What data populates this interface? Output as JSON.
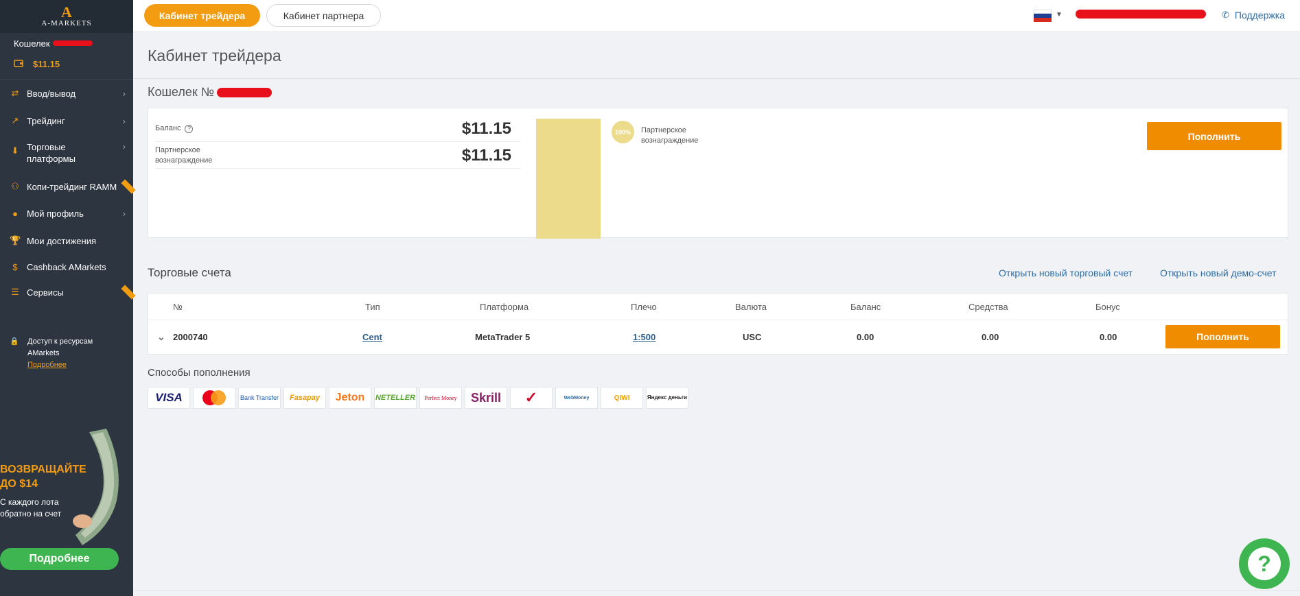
{
  "brand": {
    "name": "A-MARKETS",
    "mark": "A"
  },
  "sidebar": {
    "wallet_label": "Кошелек",
    "wallet_amount": "$11.15",
    "items": [
      {
        "label": "Ввод/вывод",
        "icon": "transfer-icon",
        "has_chevron": true
      },
      {
        "label": "Трейдинг",
        "icon": "chart-icon",
        "has_chevron": true
      },
      {
        "label": "Торговые платформы",
        "icon": "download-icon",
        "has_chevron": true
      },
      {
        "label": "Копи-трейдинг RAMM",
        "icon": "copy-trading-icon",
        "has_chevron": false,
        "badge": true
      },
      {
        "label": "Мой профиль",
        "icon": "user-icon",
        "has_chevron": true
      },
      {
        "label": "Мои достижения",
        "icon": "trophy-icon",
        "has_chevron": false
      },
      {
        "label": "Cashback AMarkets",
        "icon": "cashback-icon",
        "has_chevron": false
      },
      {
        "label": "Сервисы",
        "icon": "services-icon",
        "has_chevron": false,
        "badge": true
      }
    ],
    "access": {
      "line1": "Доступ к ресурсам",
      "line2": "AMarkets",
      "link": "Подробнее"
    },
    "promo": {
      "headline1": "ВОЗВРАЩАЙТЕ",
      "headline2": "ДО $14",
      "text1": "С каждого лота",
      "text2": "обратно на счет",
      "button": "Подробнее"
    }
  },
  "topbar": {
    "tab_active": "Кабинет трейдера",
    "tab_inactive": "Кабинет партнера",
    "support": "Поддержка"
  },
  "main": {
    "title": "Кабинет трейдера",
    "wallet_title": "Кошелек №",
    "balance_label": "Баланс",
    "balance_value": "$11.15",
    "partner_label_1": "Партнерское",
    "partner_label_2": "вознаграждение",
    "partner_value": "$11.15",
    "percent": "100%",
    "legend_1": "Партнерское",
    "legend_2": "вознаграждение",
    "topup_button": "Пополнить",
    "accounts_title": "Торговые счета",
    "open_real": "Открыть новый торговый счет",
    "open_demo": "Открыть новый демо-счет",
    "table": {
      "headers": [
        "№",
        "Тип",
        "Платформа",
        "Плечо",
        "Валюта",
        "Баланс",
        "Средства",
        "Бонус"
      ],
      "row": {
        "number": "2000740",
        "type": "Cent",
        "platform": "MetaTrader 5",
        "leverage": "1:500",
        "currency": "USC",
        "balance": "0.00",
        "funds": "0.00",
        "bonus": "0.00",
        "button": "Пополнить"
      }
    },
    "methods_title": "Способы пополнения",
    "methods": [
      "VISA",
      "Mastercard",
      "Bank Transfer",
      "Fasapay",
      "Jeton",
      "NETELLER",
      "Perfect Money",
      "Skrill",
      "Check",
      "WebMoney",
      "QIWI",
      "Яндекс деньги"
    ]
  },
  "colors": {
    "accent": "#f39c12",
    "sidebar": "#2c3540",
    "green": "#3fb551",
    "link": "#2d6da6"
  }
}
